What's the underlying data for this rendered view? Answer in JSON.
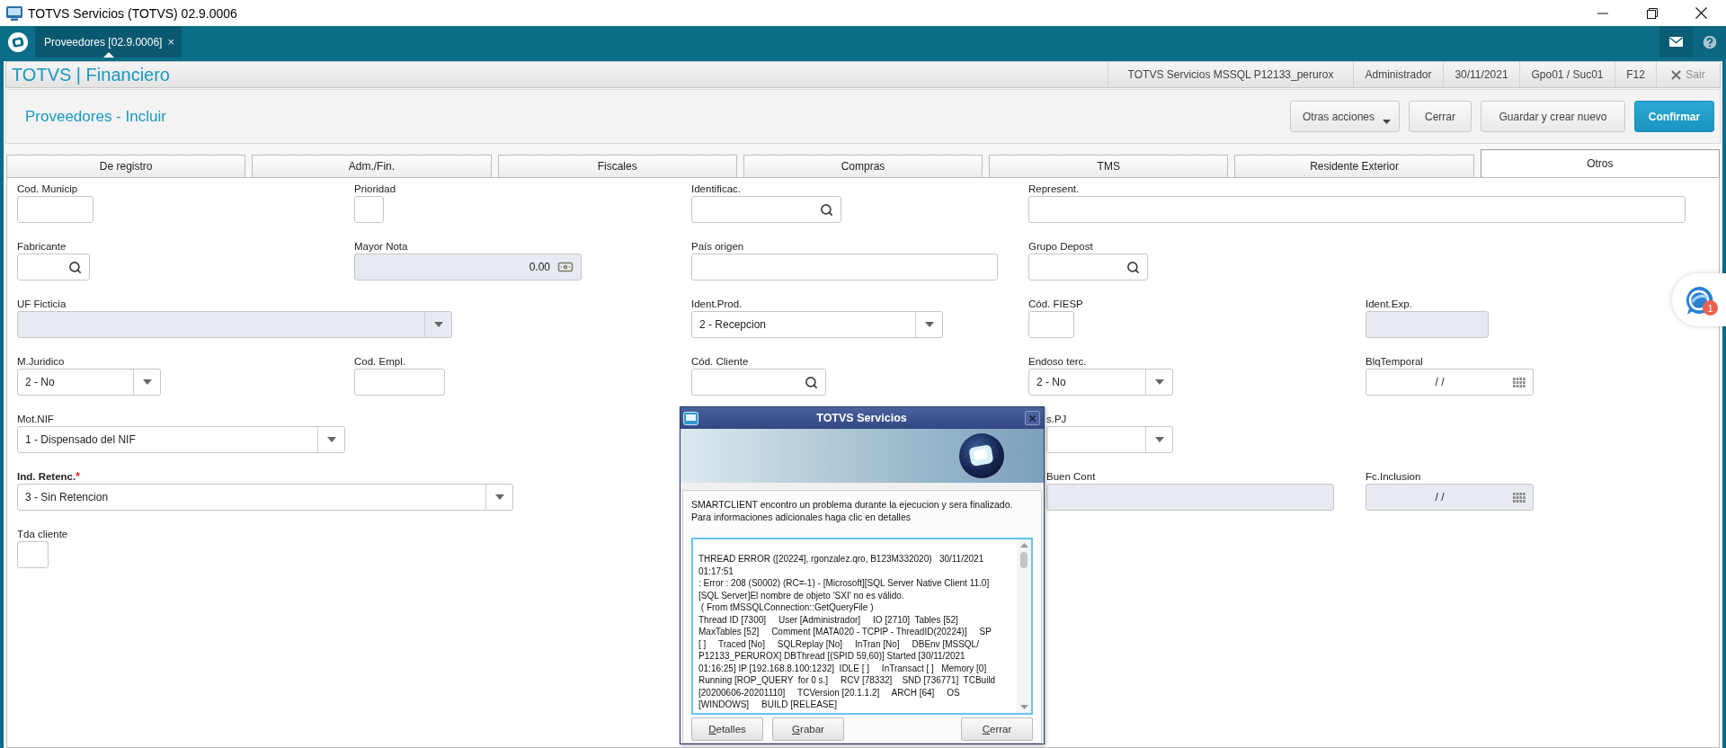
{
  "window": {
    "title": "TOTVS Servicios (TOTVS) 02.9.0006"
  },
  "app_bar": {
    "tabs": [
      {
        "label": "Proveedores [02.9.0006]",
        "close": "×",
        "selected": true
      }
    ]
  },
  "header": {
    "module": "TOTVS | Financiero",
    "info": [
      "TOTVS Servicios MSSQL P12133_perurox",
      "Administrador",
      "30/11/2021",
      "Gpo01 / Suc01",
      "F12"
    ],
    "exit": "Sair"
  },
  "page": {
    "title": "Proveedores - Incluir",
    "actions": [
      {
        "label": "Otras acciones",
        "kind": "menu"
      },
      {
        "label": "Cerrar",
        "kind": "default"
      },
      {
        "label": "Guardar y crear nuevo",
        "kind": "default"
      },
      {
        "label": "Confirmar",
        "kind": "primary"
      }
    ]
  },
  "form_tabs": [
    {
      "label": "De registro",
      "selected": false
    },
    {
      "label": "Adm./Fin.",
      "selected": false
    },
    {
      "label": "Fiscales",
      "selected": false
    },
    {
      "label": "Compras",
      "selected": false
    },
    {
      "label": "TMS",
      "selected": false
    },
    {
      "label": "Residente Exterior",
      "selected": false
    },
    {
      "label": "Otros",
      "selected": true
    }
  ],
  "form": {
    "rows": [
      {
        "fields": [
          {
            "label": "Cod. Municip",
            "kind": "text",
            "disabled": false
          },
          {
            "label": "Prioridad",
            "kind": "text",
            "disabled": false
          },
          {
            "label": "Identificac.",
            "kind": "lookup",
            "disabled": false
          },
          {
            "label": "Represent.",
            "kind": "text",
            "disabled": false
          }
        ]
      },
      {
        "fields": [
          {
            "label": "Fabricante",
            "kind": "lookup",
            "disabled": false
          },
          {
            "label": "Mayor Nota",
            "kind": "amount",
            "value": "0.00",
            "disabled": true
          },
          {
            "label": "País origen",
            "kind": "text",
            "disabled": false
          },
          {
            "label": "Grupo Depost",
            "kind": "lookup",
            "disabled": false
          }
        ]
      },
      {
        "fields": [
          {
            "label": "UF Ficticia",
            "kind": "select",
            "disabled": true
          },
          {
            "label": "Ident.Prod.",
            "kind": "select",
            "value": "2 - Recepcion",
            "disabled": false
          },
          {
            "label": "Cód. FIESP",
            "kind": "text",
            "disabled": false
          },
          {
            "label": "Ident.Exp.",
            "kind": "text",
            "disabled": true
          }
        ]
      },
      {
        "fields": [
          {
            "label": "M.Juridico",
            "kind": "select",
            "value": "2 - No",
            "disabled": false
          },
          {
            "label": "Cod. Empl.",
            "kind": "text",
            "disabled": false
          },
          {
            "label": "Cód. Cliente",
            "kind": "lookup",
            "disabled": false
          },
          {
            "label": "Endoso terc.",
            "kind": "select",
            "value": "2 - No",
            "disabled": false
          },
          {
            "label": "BlqTemporal",
            "kind": "date",
            "value": "/ /",
            "disabled": false
          }
        ]
      },
      {
        "fields": [
          {
            "label": "Mot.NIF",
            "kind": "select",
            "value": "1 - Dispensado del NIF",
            "disabled": false
          },
          {
            "label": "s.PJ",
            "kind": "select",
            "disabled": false
          }
        ]
      },
      {
        "fields": [
          {
            "label": "Ind. Retenc.",
            "required_mark": "*",
            "kind": "select",
            "value": "3 - Sin Retencion",
            "disabled": false
          },
          {
            "label": "Buen Cont",
            "kind": "text",
            "disabled": true
          },
          {
            "label": "Fc.Inclusion",
            "kind": "date",
            "value": "/ /",
            "disabled": true
          }
        ]
      },
      {
        "fields": [
          {
            "label": "Tda cliente",
            "kind": "text",
            "disabled": false
          }
        ]
      }
    ]
  },
  "chat": {
    "badge": "1"
  },
  "dialog": {
    "title": "TOTVS Servicios",
    "message": [
      "SMARTCLIENT encontro un problema durante la ejecucion y sera finalizado.",
      "Para informaciones adicionales haga clic en detalles"
    ],
    "log": [
      "THREAD ERROR ([20224], rgonzalez.qro, B123M332020)   30/11/2021",
      "01:17:51",
      ": Error : 208 (S0002) (RC=-1) - [Microsoft][SQL Server Native Client 11.0]",
      "[SQL Server]El nombre de objeto 'SXI' no es válido.",
      " ( From tMSSQLConnection::GetQueryFile )",
      "Thread ID [7300]     User [Administrador]     IO [2710]  Tables [52]",
      "MaxTables [52]     Comment [MATA020 - TCPIP - ThreadID(20224)]     SP",
      "[ ]     Traced [No]     SQLReplay [No]     InTran [No]     DBEnv [MSSQL/",
      "P12133_PERUROX] DBThread [(SPID 59,60)] Started [30/11/2021",
      "01:16:25] IP [192.168.8.100:1232]  IDLE [ ]     InTransact [ ]   Memory [0]",
      "Running [ROP_QUERY  for 0 s.]     RCV [78332]    SND [736771]  TCBuild",
      "[20200606-20201110]     TCVersion [20.1.1.2]     ARCH [64]     OS",
      "[WINDOWS]     BUILD [RELEASE]"
    ],
    "buttons": [
      "Detalles",
      "Grabar",
      "Cerrar"
    ]
  }
}
